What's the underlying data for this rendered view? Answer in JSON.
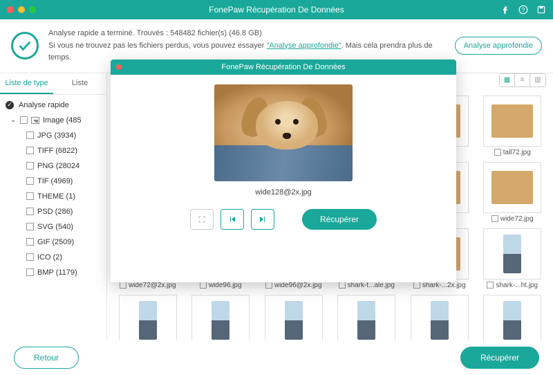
{
  "titlebar": {
    "title": "FonePaw Récupération De Données"
  },
  "status": {
    "line1": "Analyse rapide a terminé. Trouvés : 548482 fichier(s) (46.8 GB)",
    "line2a": "Si vous ne trouvez pas les fichiers perdus, vous pouvez essayer ",
    "deep_link": "\"Analyse approfondie\"",
    "line2b": ". Mais cela prendra plus de temps.",
    "deep_btn": "Analyse approfondie"
  },
  "sidebar": {
    "tab1": "Liste de type",
    "tab2": "Liste",
    "root": "Analyse rapide",
    "parent": "Image (485",
    "items": [
      "JPG (3934)",
      "TIFF (6822)",
      "PNG (28024",
      "TIF (4969)",
      "THEME (1)",
      "PSD (286)",
      "SVG (540)",
      "GIF (2509)",
      "ICO (2)",
      "BMP (1179)"
    ]
  },
  "grid": {
    "r1": [
      "",
      "",
      "",
      "",
      "pg",
      "tall72.jpg"
    ],
    "r2": [
      "",
      "",
      "",
      "",
      "pg",
      "wide72.jpg"
    ],
    "r3": [
      "wide72@2x.jpg",
      "wide96.jpg",
      "wide96@2x.jpg",
      "shark-t...ale.jpg",
      "shark-...2x.jpg",
      "shark-...ht.jpg"
    ]
  },
  "modal": {
    "title": "FonePaw Récupération De Données",
    "filename": "wide128@2x.jpg",
    "recover": "Récupérer"
  },
  "footer": {
    "back": "Retour",
    "recover": "Récupérer"
  }
}
